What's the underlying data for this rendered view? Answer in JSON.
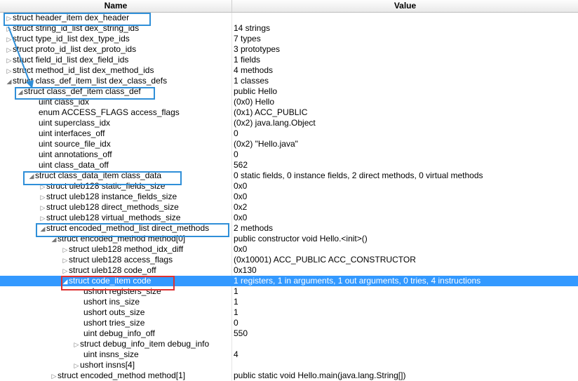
{
  "columns": {
    "name": "Name",
    "value": "Value"
  },
  "highlight_colors": {
    "blue": "#2f8fd8",
    "red": "#e03131",
    "selection": "#3399ff"
  },
  "rows": [
    {
      "name": "struct header_item dex_header",
      "value": "",
      "depth": 0,
      "toggle": "collapsed"
    },
    {
      "name": "struct string_id_list dex_string_ids",
      "value": "14 strings",
      "depth": 0,
      "toggle": "collapsed"
    },
    {
      "name": "struct type_id_list dex_type_ids",
      "value": "7 types",
      "depth": 0,
      "toggle": "collapsed"
    },
    {
      "name": "struct proto_id_list dex_proto_ids",
      "value": "3 prototypes",
      "depth": 0,
      "toggle": "collapsed"
    },
    {
      "name": "struct field_id_list dex_field_ids",
      "value": "1 fields",
      "depth": 0,
      "toggle": "collapsed"
    },
    {
      "name": "struct method_id_list dex_method_ids",
      "value": "4 methods",
      "depth": 0,
      "toggle": "collapsed"
    },
    {
      "name": "struct class_def_item_list dex_class_defs",
      "value": "1 classes",
      "depth": 0,
      "toggle": "expanded"
    },
    {
      "name": "struct class_def_item class_def",
      "value": "public Hello",
      "depth": 1,
      "toggle": "expanded"
    },
    {
      "name": "uint class_idx",
      "value": "(0x0) Hello",
      "depth": 2,
      "toggle": "none"
    },
    {
      "name": "enum ACCESS_FLAGS access_flags",
      "value": "(0x1) ACC_PUBLIC",
      "depth": 2,
      "toggle": "none"
    },
    {
      "name": "uint superclass_idx",
      "value": "(0x2) java.lang.Object",
      "depth": 2,
      "toggle": "none"
    },
    {
      "name": "uint interfaces_off",
      "value": "0",
      "depth": 2,
      "toggle": "none"
    },
    {
      "name": "uint source_file_idx",
      "value": "(0x2) \"Hello.java\"",
      "depth": 2,
      "toggle": "none"
    },
    {
      "name": "uint annotations_off",
      "value": "0",
      "depth": 2,
      "toggle": "none"
    },
    {
      "name": "uint class_data_off",
      "value": "562",
      "depth": 2,
      "toggle": "none"
    },
    {
      "name": "struct class_data_item class_data",
      "value": "0 static fields, 0 instance fields, 2 direct methods, 0 virtual methods",
      "depth": 2,
      "toggle": "expanded"
    },
    {
      "name": "struct uleb128 static_fields_size",
      "value": "0x0",
      "depth": 3,
      "toggle": "collapsed"
    },
    {
      "name": "struct uleb128 instance_fields_size",
      "value": "0x0",
      "depth": 3,
      "toggle": "collapsed"
    },
    {
      "name": "struct uleb128 direct_methods_size",
      "value": "0x2",
      "depth": 3,
      "toggle": "collapsed"
    },
    {
      "name": "struct uleb128 virtual_methods_size",
      "value": "0x0",
      "depth": 3,
      "toggle": "collapsed"
    },
    {
      "name": "struct encoded_method_list direct_methods",
      "value": "2 methods",
      "depth": 3,
      "toggle": "expanded"
    },
    {
      "name": "struct encoded_method method[0]",
      "value": "public constructor void Hello.<init>()",
      "depth": 4,
      "toggle": "expanded"
    },
    {
      "name": "struct uleb128 method_idx_diff",
      "value": "0x0",
      "depth": 5,
      "toggle": "collapsed"
    },
    {
      "name": "struct uleb128 access_flags",
      "value": "(0x10001) ACC_PUBLIC ACC_CONSTRUCTOR",
      "depth": 5,
      "toggle": "collapsed"
    },
    {
      "name": "struct uleb128 code_off",
      "value": "0x130",
      "depth": 5,
      "toggle": "collapsed"
    },
    {
      "name": "struct code_item code",
      "value": "1 registers, 1 in arguments, 1 out arguments, 0 tries, 4 instructions",
      "depth": 5,
      "toggle": "expanded",
      "selected": true
    },
    {
      "name": "ushort registers_size",
      "value": "1",
      "depth": 6,
      "toggle": "none"
    },
    {
      "name": "ushort ins_size",
      "value": "1",
      "depth": 6,
      "toggle": "none"
    },
    {
      "name": "ushort outs_size",
      "value": "1",
      "depth": 6,
      "toggle": "none"
    },
    {
      "name": "ushort tries_size",
      "value": "0",
      "depth": 6,
      "toggle": "none"
    },
    {
      "name": "uint debug_info_off",
      "value": "550",
      "depth": 6,
      "toggle": "none"
    },
    {
      "name": "struct debug_info_item debug_info",
      "value": "",
      "depth": 6,
      "toggle": "collapsed"
    },
    {
      "name": "uint insns_size",
      "value": "4",
      "depth": 6,
      "toggle": "none"
    },
    {
      "name": "ushort insns[4]",
      "value": "",
      "depth": 6,
      "toggle": "collapsed"
    },
    {
      "name": "struct encoded_method method[1]",
      "value": "public static void Hello.main(java.lang.String[])",
      "depth": 4,
      "toggle": "collapsed"
    }
  ]
}
